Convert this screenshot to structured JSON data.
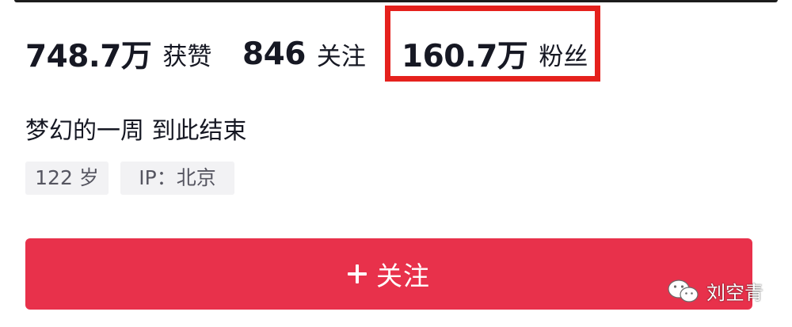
{
  "profile": {
    "stats": {
      "likes": {
        "value": "748.7万",
        "label": "获赞"
      },
      "following": {
        "value": "846",
        "label": "关注"
      },
      "followers": {
        "value": "160.7万",
        "label": "粉丝"
      }
    },
    "bio": "梦幻的一周 到此结束",
    "tags": {
      "age": "122 岁",
      "ip": "IP：北京"
    },
    "follow_button": {
      "icon": "plus-icon",
      "label": "关注"
    }
  },
  "annotation": {
    "highlight_color": "#e5211d",
    "target": "followers"
  },
  "watermark": {
    "icon": "wechat-icon",
    "text": "刘空青"
  },
  "colors": {
    "accent": "#e8314b",
    "text": "#161823",
    "tag_background": "#f2f2f4"
  }
}
